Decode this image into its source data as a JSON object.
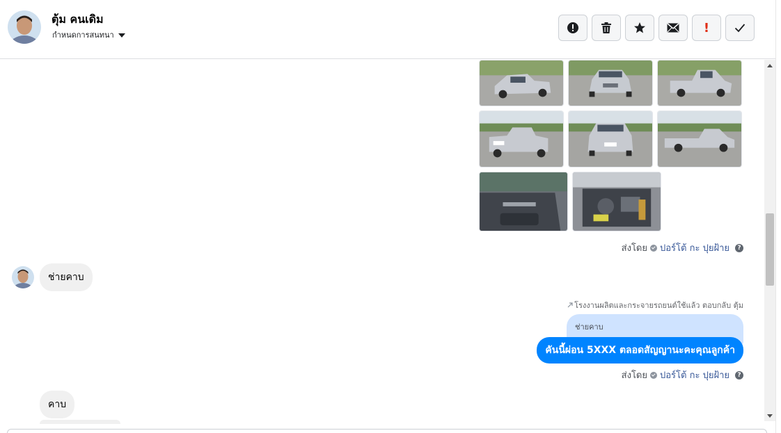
{
  "header": {
    "contact_name": "ตุ้ม คนเดิม",
    "assign_label": "กำหนดการสนทนา",
    "toolbar": [
      {
        "icon": "alert-circle-icon",
        "name": "mark-spam-button"
      },
      {
        "icon": "trash-icon",
        "name": "delete-button"
      },
      {
        "icon": "star-icon",
        "name": "star-button"
      },
      {
        "icon": "envelope-icon",
        "name": "mark-unread-button"
      },
      {
        "icon": "exclamation-icon",
        "name": "follow-up-button",
        "glyph": "!"
      },
      {
        "icon": "checkmark-icon",
        "name": "mark-done-button"
      }
    ]
  },
  "messages": {
    "photos_sent_by_prefix": "ส่งโดย",
    "photos_sent_by_name": "ปอร์โต้ กะ ปุยฝ้าย",
    "incoming_1": "ช่ายคาบ",
    "reply_note": "โรงงานผลิตและกระจายรถยนต์ใช้แล้ว ตอบกลับ ตุ้ม",
    "quoted_text": "ช่ายคาบ",
    "outgoing_1": "คันนี้ผ่อน 5XXX  ตลอดสัญญานะคะคุณลูกค้า",
    "outgoing_sent_by_prefix": "ส่งโดย",
    "outgoing_sent_by_name": "ปอร์โต้ กะ ปุยฝ้าย",
    "incoming_2": "คาบ",
    "help_glyph": "?"
  },
  "colors": {
    "outgoing_bubble": "#0084ff",
    "incoming_bubble": "#f0f0f0",
    "quoted_bubble": "#cfe3ff",
    "link": "#385898",
    "danger": "#e02e16"
  }
}
